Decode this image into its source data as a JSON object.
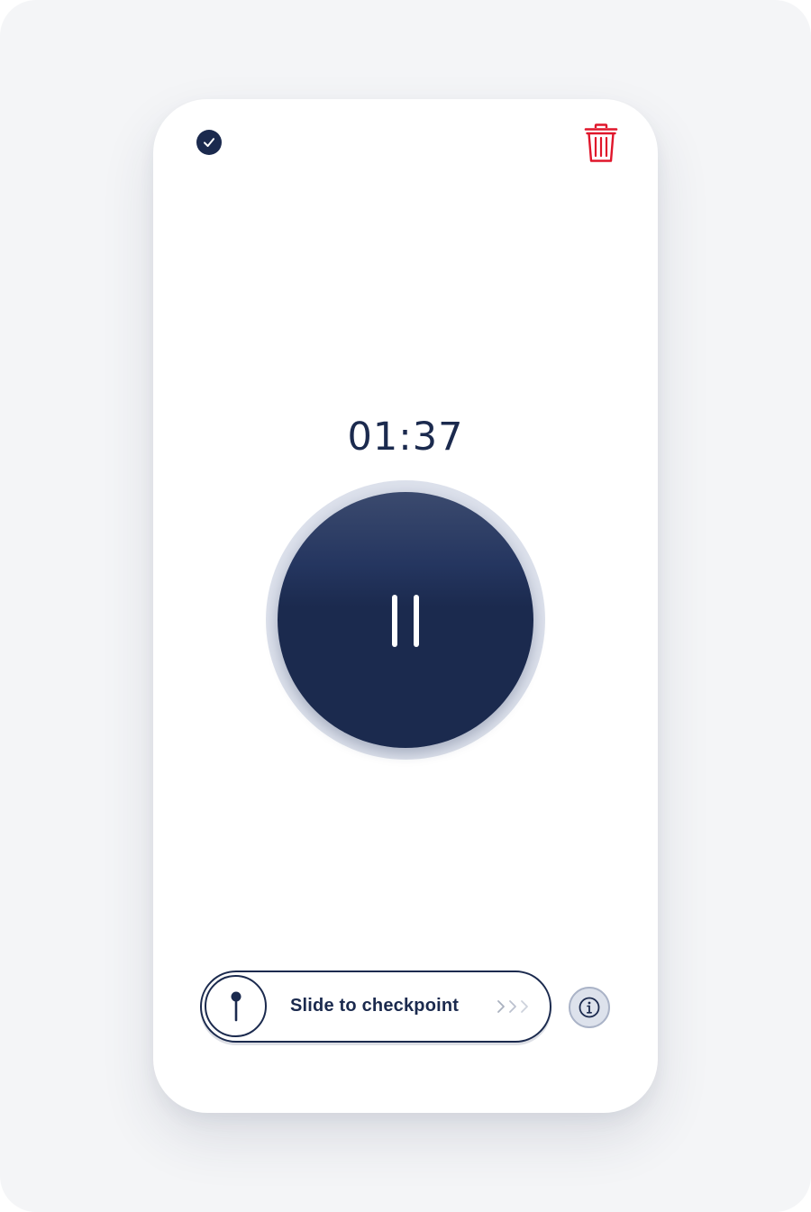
{
  "header": {
    "confirm_icon": "checkmark-circle-icon",
    "delete_icon": "trash-icon",
    "delete_color": "#e0162b"
  },
  "recorder": {
    "elapsed_time": "01:37",
    "state": "recording",
    "control_icon": "pause-icon",
    "accent": "#1b2a4e"
  },
  "checkpoint_slider": {
    "label": "Slide to checkpoint",
    "knob_icon": "pin-icon",
    "hint_icon": "chevrons-right-icon"
  },
  "info": {
    "icon": "info-icon"
  }
}
